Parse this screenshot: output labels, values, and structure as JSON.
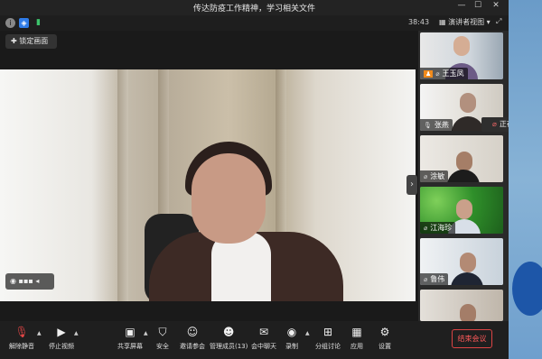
{
  "window": {
    "title": "传达防疫工作精神，学习相关文件",
    "minimize": "—",
    "maximize": "☐",
    "close": "✕"
  },
  "subbar": {
    "time": "38:43",
    "view_label": "演讲者视图",
    "view_caret": "▾",
    "fullscreen_icon": "⤢",
    "info_icon": "i",
    "shield_icon": "◈",
    "signal_icon": "▮"
  },
  "main": {
    "lock_button": "锁定画面",
    "video_control": "◉ ▪▪▪  ◂"
  },
  "gallery": {
    "toggle": "›",
    "tiles": [
      {
        "name": "王玉凤"
      },
      {
        "name": "张燕"
      },
      {
        "name": "涂敏"
      },
      {
        "name": "江海珍"
      },
      {
        "name": "鲁伟"
      },
      {
        "name": ""
      }
    ],
    "speaker_tip": "正在讲话: 张燕;"
  },
  "toolbar": {
    "items": [
      {
        "label": "解除静音",
        "icon": "mic-off-icon"
      },
      {
        "label": "停止视频",
        "icon": "video-icon"
      },
      {
        "label": "共享屏幕",
        "icon": "share-screen-icon"
      },
      {
        "label": "安全",
        "icon": "shield-icon"
      },
      {
        "label": "邀请参会",
        "icon": "invite-icon"
      },
      {
        "label": "管理成员(13)",
        "icon": "members-icon"
      },
      {
        "label": "会中聊天",
        "icon": "chat-icon"
      },
      {
        "label": "录制",
        "icon": "record-icon"
      },
      {
        "label": "分组讨论",
        "icon": "breakout-icon"
      },
      {
        "label": "应用",
        "icon": "apps-icon"
      },
      {
        "label": "设置",
        "icon": "settings-icon"
      }
    ],
    "end_meeting": "结束会议"
  },
  "colors": {
    "end_button": "#ff5a5a",
    "toolbar_bg": "#1f1f1f",
    "signal": "#3cc36b",
    "shield": "#2f7ce8"
  }
}
